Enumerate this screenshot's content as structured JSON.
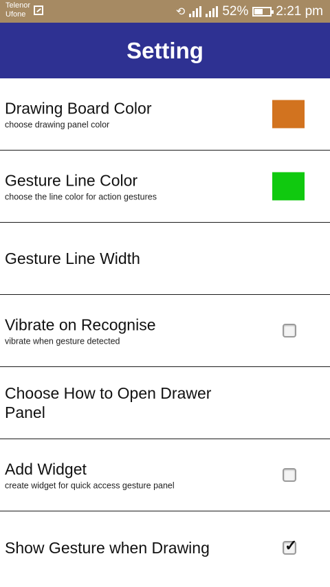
{
  "status_bar": {
    "carrier1": "Telenor",
    "carrier2": "Ufone",
    "battery": "52%",
    "time": "2:21 pm"
  },
  "header": {
    "title": "Setting"
  },
  "settings": [
    {
      "title": "Drawing Board Color",
      "subtitle": "choose drawing panel color",
      "swatch_color": "#d2731f"
    },
    {
      "title": "Gesture Line Color",
      "subtitle": "choose the line color for action gestures",
      "swatch_color": "#10c90f"
    },
    {
      "title": "Gesture Line Width"
    },
    {
      "title": "Vibrate on Recognise",
      "subtitle": "vibrate when gesture detected",
      "checked": false
    },
    {
      "title": "Choose How to Open Drawer Panel"
    },
    {
      "title": "Add Widget",
      "subtitle": "create widget for quick access gesture panel",
      "checked": false
    },
    {
      "title": "Show Gesture when Drawing",
      "checked": true
    }
  ],
  "colors": {
    "status_bar": "#a68a63",
    "app_bar": "#2e3192"
  }
}
